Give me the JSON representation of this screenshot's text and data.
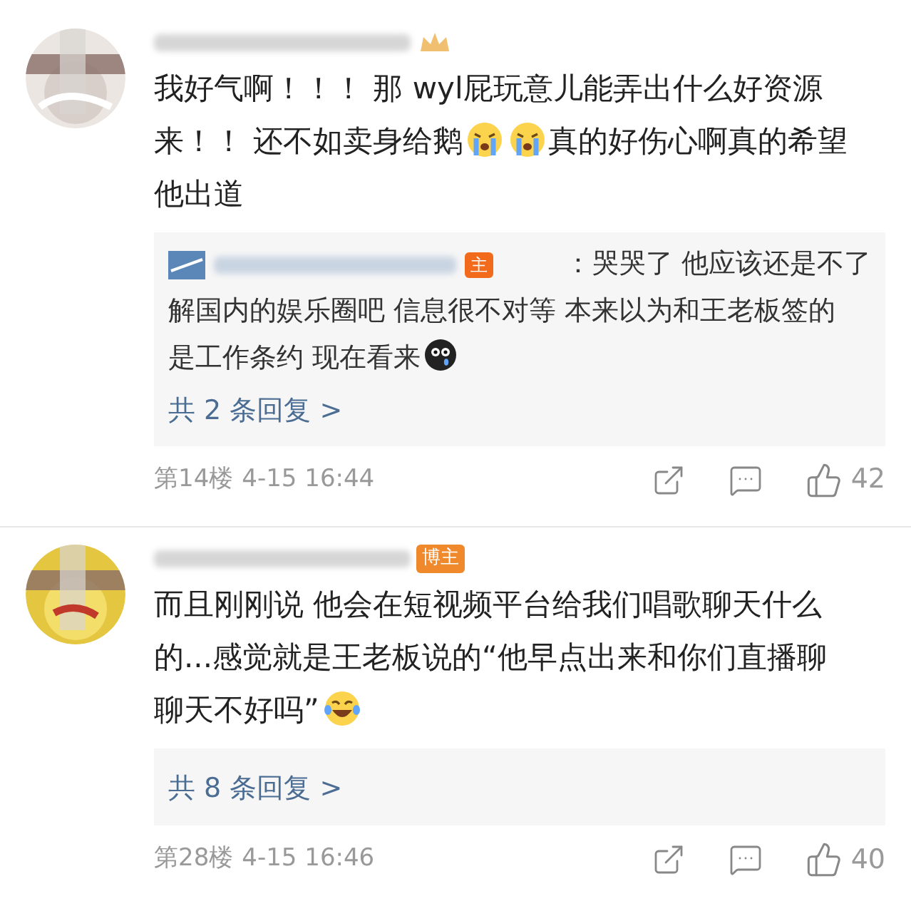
{
  "comments": [
    {
      "badge": {
        "kind": "crown"
      },
      "content": [
        {
          "kind": "text",
          "text": "我好气啊！！！ 那 wyl屁玩意儿能弄出什么好资源来！！ 还不如卖身给鹅"
        },
        {
          "kind": "cry"
        },
        {
          "kind": "cry"
        },
        {
          "kind": "text",
          "text": "真的好伤心啊真的希望他出道"
        }
      ],
      "reply": {
        "badge": "主",
        "lines": [
          [
            {
              "kind": "text",
              "text": "：哭哭了 他应该还是不了"
            }
          ],
          [
            {
              "kind": "text",
              "text": "解国内的娱乐圈吧 信息很不对等 本来以为和王老板签的是工作条约 现在看来"
            },
            {
              "kind": "shock"
            }
          ]
        ],
        "more": "共 2 条回复 >"
      },
      "floor": "第14楼",
      "time": "4-15 16:44",
      "likes": "42"
    },
    {
      "badge": {
        "kind": "text",
        "text": "博主"
      },
      "content": [
        {
          "kind": "text",
          "text": "而且刚刚说 他会在短视频平台给我们唱歌聊天什么的...感觉就是王老板说的“他早点出来和你们直播聊聊天不好吗”"
        },
        {
          "kind": "laugh"
        }
      ],
      "reply": {
        "more": "共 8 条回复 >"
      },
      "floor": "第28楼",
      "time": "4-15 16:46",
      "likes": "40"
    }
  ]
}
